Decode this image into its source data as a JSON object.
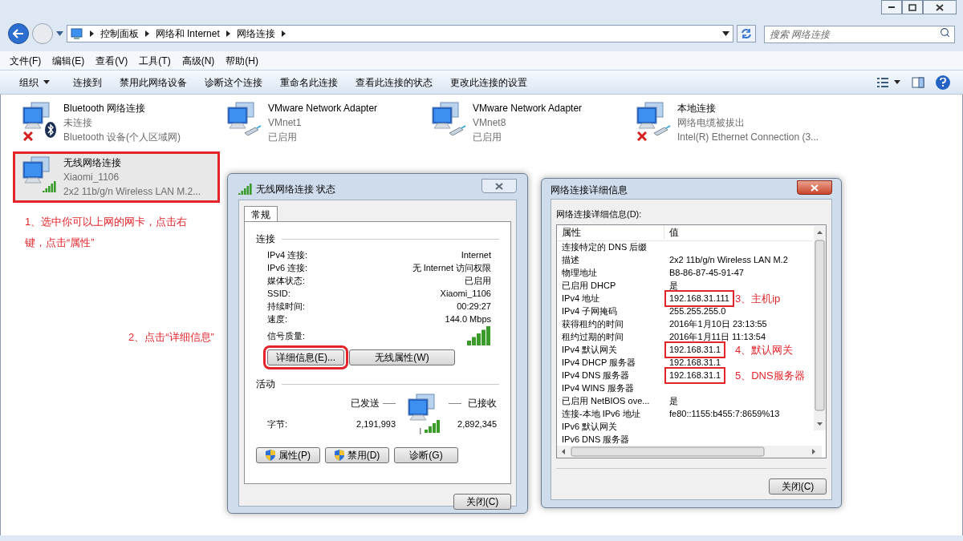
{
  "address_bar": {
    "breadcrumbs": [
      "控制面板",
      "网络和 Internet",
      "网络连接"
    ]
  },
  "search": {
    "placeholder": "搜索 网络连接"
  },
  "menu": [
    "文件(F)",
    "编辑(E)",
    "查看(V)",
    "工具(T)",
    "高级(N)",
    "帮助(H)"
  ],
  "toolbar": [
    {
      "label": "组织",
      "kind": "dropdown"
    },
    {
      "label": "连接到",
      "kind": "button"
    },
    {
      "label": "禁用此网络设备",
      "kind": "button"
    },
    {
      "label": "诊断这个连接",
      "kind": "button"
    },
    {
      "label": "重命名此连接",
      "kind": "button"
    },
    {
      "label": "查看此连接的状态",
      "kind": "button"
    },
    {
      "label": "更改此连接的设置",
      "kind": "button"
    }
  ],
  "adapters": [
    {
      "name": "Bluetooth 网络连接",
      "status": "未连接",
      "device": "Bluetooth 设备(个人区域网)",
      "kind": "bluetooth",
      "disconnected": true,
      "selected": false,
      "marked": false
    },
    {
      "name": "VMware Network Adapter",
      "status": "VMnet1",
      "device": "已启用",
      "kind": "cable",
      "disconnected": false,
      "selected": false,
      "marked": false
    },
    {
      "name": "VMware Network Adapter",
      "status": "VMnet8",
      "device": "已启用",
      "kind": "cable",
      "disconnected": false,
      "selected": false,
      "marked": false
    },
    {
      "name": "本地连接",
      "status": "网络电缆被拔出",
      "device": "Intel(R) Ethernet Connection (3...",
      "kind": "cable",
      "disconnected": true,
      "selected": false,
      "marked": false
    },
    {
      "name": "无线网络连接",
      "status": "Xiaomi_1106",
      "device": "2x2 11b/g/n Wireless LAN M.2...",
      "kind": "wireless",
      "disconnected": false,
      "selected": true,
      "marked": true
    }
  ],
  "note_1": "1、选中你可以上网的网卡，点击右键，点击“属性”",
  "note_2": "2、点击“详细信息”",
  "status_dialog": {
    "title": "无线网络连接 状态",
    "tabs": [
      {
        "label": "常规",
        "selected": true
      }
    ],
    "connection_heading": "连接",
    "rows": [
      {
        "label": "IPv4 连接:",
        "value": "Internet"
      },
      {
        "label": "IPv6 连接:",
        "value": "无 Internet 访问权限"
      },
      {
        "label": "媒体状态:",
        "value": "已启用"
      },
      {
        "label": "SSID:",
        "value": "Xiaomi_1106"
      },
      {
        "label": "持续时间:",
        "value": "00:29:27"
      },
      {
        "label": "速度:",
        "value": "144.0 Mbps"
      }
    ],
    "signal_label": "信号质量:",
    "buttons": [
      {
        "label": "详细信息(E)...",
        "marked": true
      },
      {
        "label": "无线属性(W)",
        "marked": false
      }
    ],
    "activity_heading": "活动",
    "sent_label": "已发送",
    "received_label": "已接收",
    "bytes_label": "字节:",
    "bytes_sent": "2,191,993",
    "bytes_received": "2,892,345",
    "action_buttons": [
      {
        "label": "属性(P)",
        "shield": true
      },
      {
        "label": "禁用(D)",
        "shield": true
      },
      {
        "label": "诊断(G)",
        "shield": false
      }
    ],
    "close": "关闭(C)"
  },
  "details_dialog": {
    "title": "网络连接详细信息",
    "list_label": "网络连接详细信息(D):",
    "columns": [
      "属性",
      "值"
    ],
    "rows": [
      {
        "property": "连接特定的 DNS 后缀",
        "value": ""
      },
      {
        "property": "描述",
        "value": "2x2 11b/g/n Wireless LAN M.2"
      },
      {
        "property": "物理地址",
        "value": "B8-86-87-45-91-47"
      },
      {
        "property": "已启用 DHCP",
        "value": "是"
      },
      {
        "property": "IPv4 地址",
        "value": "192.168.31.111",
        "marked": true,
        "note": "3、主机ip"
      },
      {
        "property": "IPv4 子网掩码",
        "value": "255.255.255.0"
      },
      {
        "property": "获得租约的时间",
        "value": "2016年1月10日 23:13:55"
      },
      {
        "property": "租约过期的时间",
        "value": "2016年1月11日 11:13:54"
      },
      {
        "property": "IPv4 默认网关",
        "value": "192.168.31.1",
        "marked": true,
        "note": "4、默认网关"
      },
      {
        "property": "IPv4 DHCP 服务器",
        "value": "192.168.31.1"
      },
      {
        "property": "IPv4 DNS 服务器",
        "value": "192.168.31.1",
        "marked": true,
        "note": "5、DNS服务器"
      },
      {
        "property": "IPv4 WINS 服务器",
        "value": ""
      },
      {
        "property": "已启用 NetBIOS ove...",
        "value": "是"
      },
      {
        "property": "连接-本地 IPv6 地址",
        "value": "fe80::1155:b455:7:8659%13"
      },
      {
        "property": "IPv6 默认网关",
        "value": ""
      },
      {
        "property": "IPv6 DNS 服务器",
        "value": ""
      }
    ],
    "close": "关闭(C)"
  }
}
